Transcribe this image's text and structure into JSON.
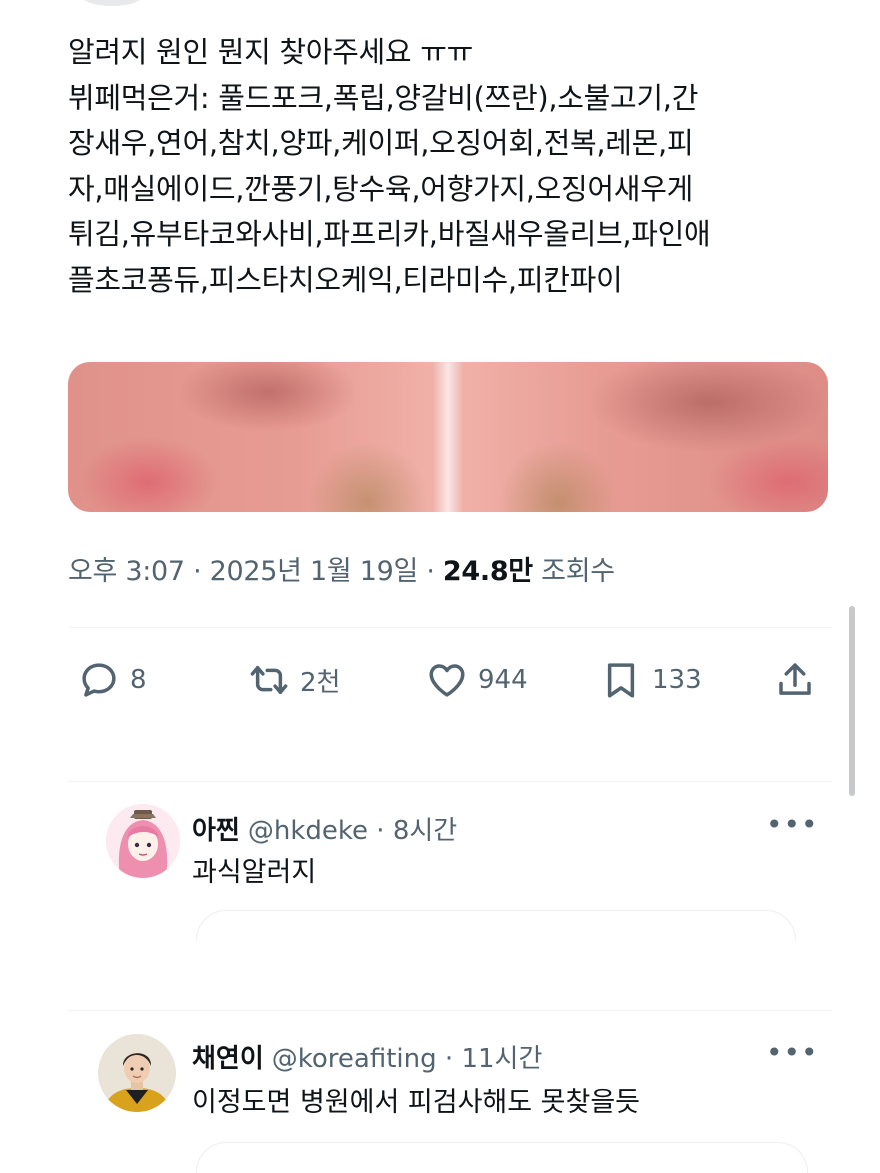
{
  "tweet": {
    "lines": [
      "알려지 원인 뭔지 찾아주세요 ㅠㅠ",
      "뷔페먹은거: 풀드포크,폭립,양갈비(쯔란),소불고기,간",
      "장새우,연어,참치,양파,케이퍼,오징어회,전복,레몬,피",
      "자,매실에이드,깐풍기,탕수육,어향가지,오징어새우게",
      "튀김,유부타코와사비,파프리카,바질새우올리브,파인애",
      "플초코퐁듀,피스타치오케익,티라미수,피칸파이"
    ],
    "time": "오후 3:07",
    "date": "2025년 1월 19일",
    "views_count": "24.8만",
    "views_label": "조회수"
  },
  "actions": {
    "replies": "8",
    "retweets": "2천",
    "likes": "944",
    "bookmarks": "133"
  },
  "replies": [
    {
      "name": "아찐",
      "handle": "@hkdeke",
      "time": "8시간",
      "text": "과식알러지"
    },
    {
      "name": "채연이",
      "handle": "@koreafiting",
      "time": "11시간",
      "text": "이정도면 병원에서 피검사해도 못찾을듯"
    }
  ],
  "icons": {
    "reply": "reply-icon",
    "retweet": "retweet-icon",
    "like": "heart-icon",
    "bookmark": "bookmark-icon",
    "share": "share-icon",
    "more": "more-icon"
  },
  "colors": {
    "text": "#0f1419",
    "secondary": "#536471",
    "divider": "#eff3f4"
  }
}
